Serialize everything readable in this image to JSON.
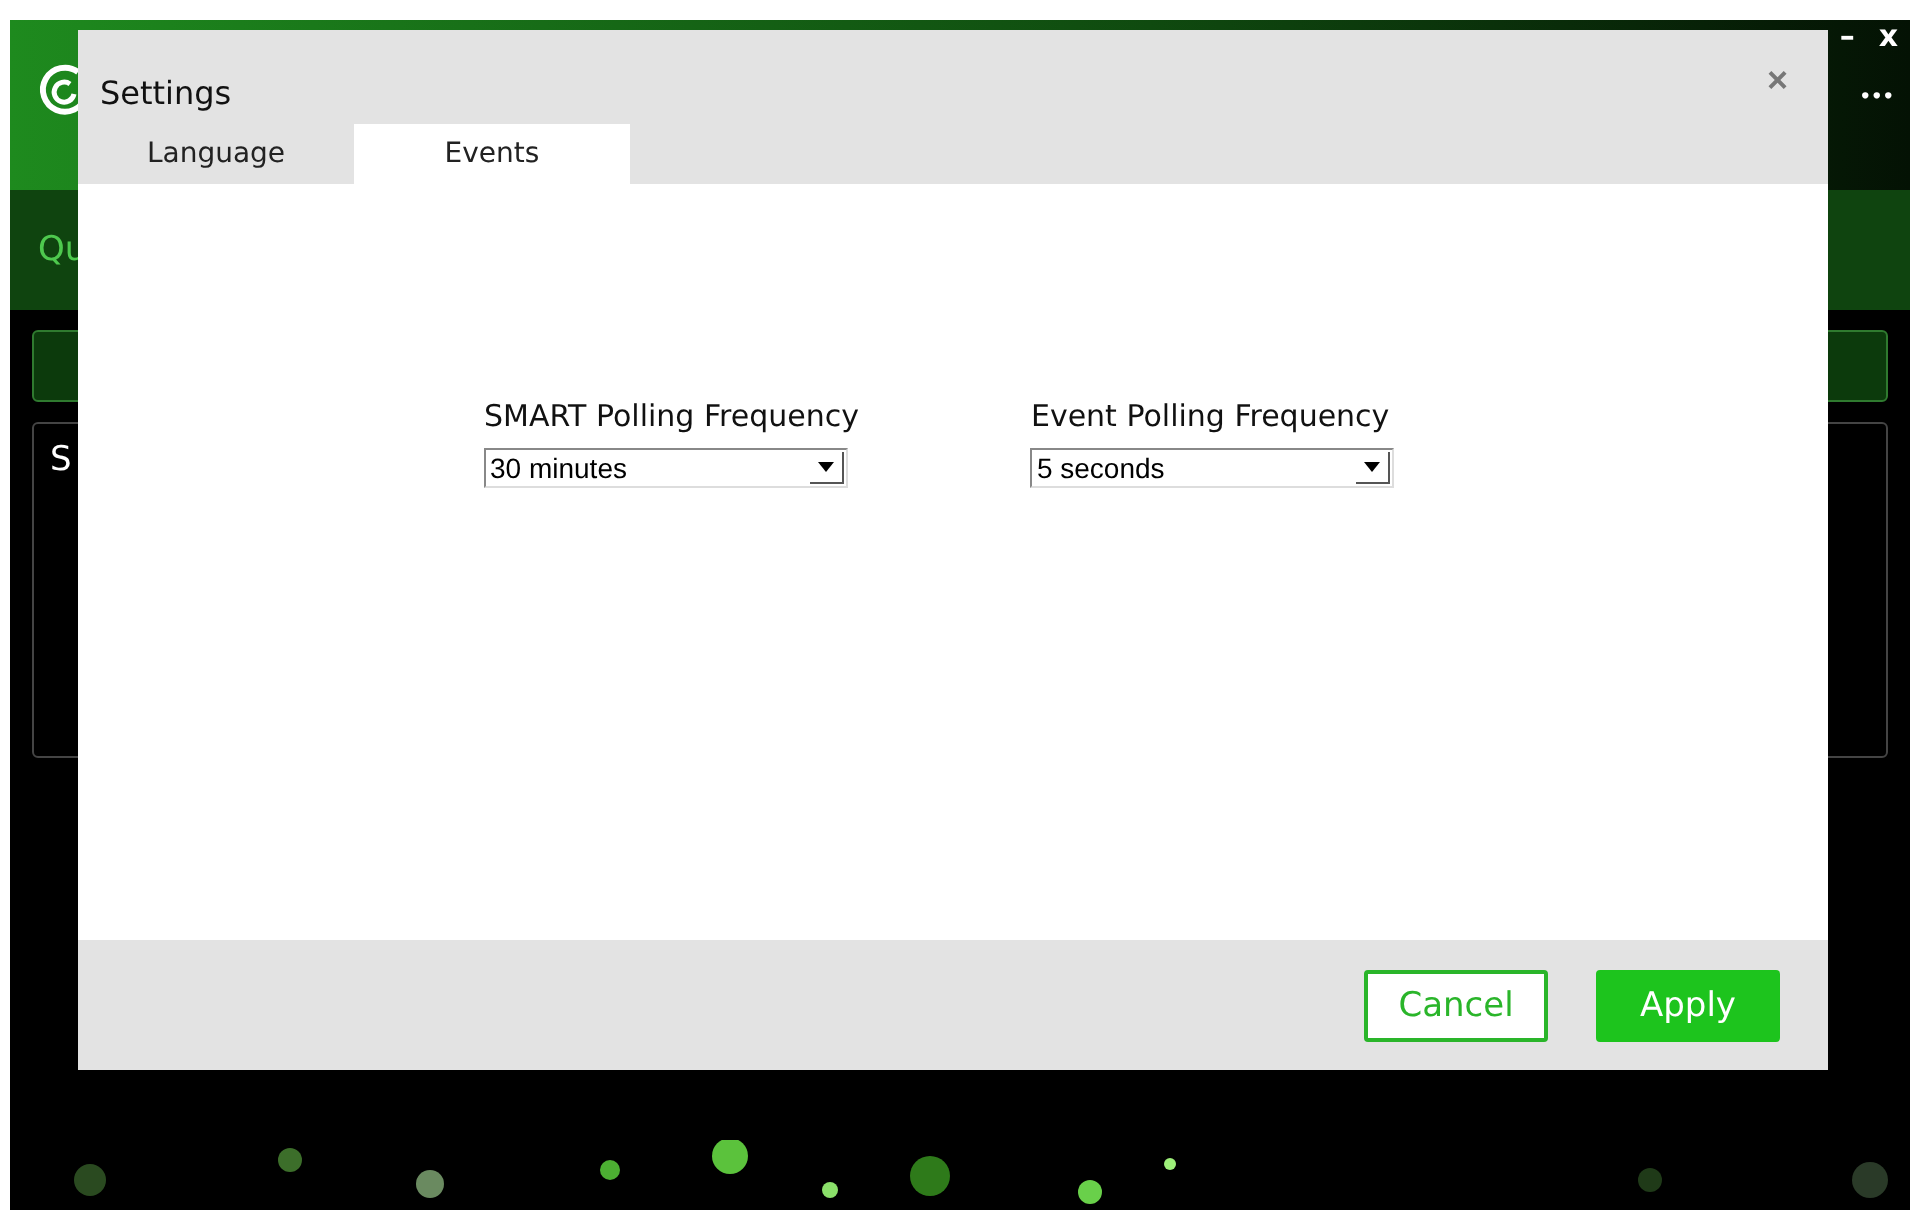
{
  "app": {
    "window_controls": [
      "–",
      "x"
    ],
    "menu": "•••",
    "section_heading": "Qu",
    "panel_title": "S"
  },
  "dialog": {
    "title": "Settings",
    "close": "×",
    "tabs": [
      {
        "label": "Language",
        "selected": false
      },
      {
        "label": "Events",
        "selected": true
      }
    ],
    "fields": [
      {
        "label": "SMART Polling Frequency",
        "value": "30 minutes"
      },
      {
        "label": "Event Polling Frequency",
        "value": "5 seconds"
      }
    ],
    "buttons": [
      {
        "label": "Cancel",
        "kind": "secondary"
      },
      {
        "label": "Apply",
        "kind": "primary"
      }
    ]
  }
}
